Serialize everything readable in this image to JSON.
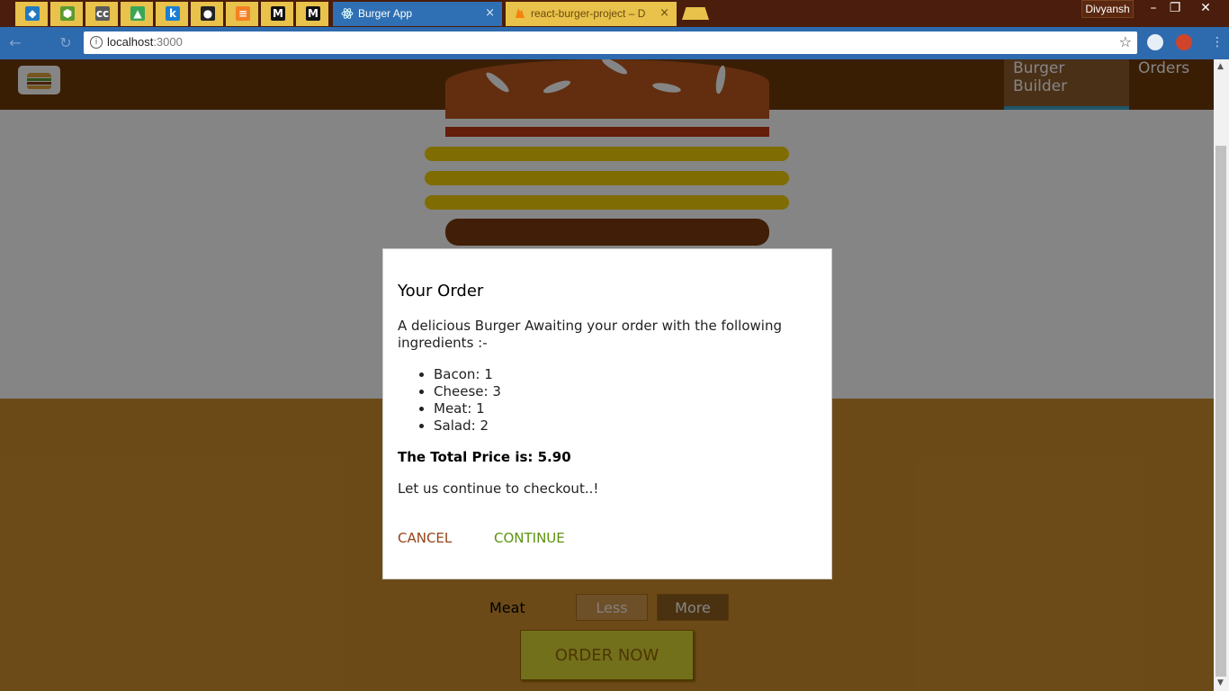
{
  "browser": {
    "pinned_tabs": [
      {
        "icon": "bird-icon",
        "color": "#1f7ac2",
        "glyph": "◆"
      },
      {
        "icon": "nodejs-icon",
        "color": "#5b9b2e",
        "glyph": "⬢"
      },
      {
        "icon": "cc-icon",
        "color": "#5a5a5a",
        "glyph": "cc"
      },
      {
        "icon": "drive-icon",
        "color": "#3aa757",
        "glyph": "▲"
      },
      {
        "icon": "k-icon",
        "color": "#1a7fd4",
        "glyph": "k"
      },
      {
        "icon": "github-icon",
        "color": "#222222",
        "glyph": "●"
      },
      {
        "icon": "stackoverflow-icon",
        "color": "#f48024",
        "glyph": "≡"
      },
      {
        "icon": "medium-icon",
        "color": "#111111",
        "glyph": "M"
      },
      {
        "icon": "medium-icon",
        "color": "#111111",
        "glyph": "M"
      }
    ],
    "tabs": [
      {
        "title": "Burger App",
        "close": "×",
        "active": true
      },
      {
        "title": "react-burger-project – D",
        "close": "×",
        "active": false
      }
    ],
    "user": "Divyansh",
    "window_controls": [
      "–",
      "❐",
      "✕"
    ],
    "url_host": "localhost",
    "url_port": ":3000",
    "colors": {
      "tabbar": "#4a1d0c",
      "toolbar": "#2e6aae",
      "tab": "#e8c24a"
    }
  },
  "app": {
    "nav": {
      "builder": "Burger Builder",
      "orders": "Orders"
    },
    "controls": {
      "meat_label": "Meat",
      "less": "Less",
      "more": "More",
      "order_now": "ORDER NOW"
    },
    "modal": {
      "title": "Your Order",
      "description": "A delicious Burger Awaiting your order with the following ingredients :-",
      "ingredients": [
        {
          "name": "Bacon",
          "qty": "1"
        },
        {
          "name": "Cheese",
          "qty": "3"
        },
        {
          "name": "Meat",
          "qty": "1"
        },
        {
          "name": "Salad",
          "qty": "2"
        }
      ],
      "total_label": "The Total Price is: ",
      "total_value": "5.90",
      "continue_question": "Let us continue to checkout..!",
      "cancel": "CANCEL",
      "continue": "CONTINUE"
    },
    "colors": {
      "nav": "#703b09",
      "controls_bg": "#cf8f2e",
      "cancel": "#944317",
      "continue": "#5c9210",
      "order_btn": "#dad735"
    }
  }
}
